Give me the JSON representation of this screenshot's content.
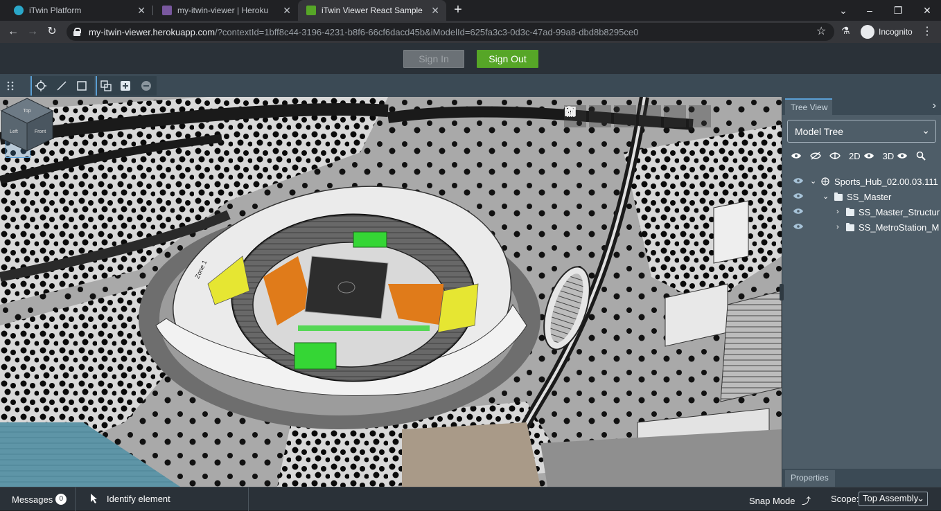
{
  "browser": {
    "tabs": [
      {
        "title": "iTwin Platform",
        "active": false
      },
      {
        "title": "my-itwin-viewer | Heroku",
        "active": false
      },
      {
        "title": "iTwin Viewer React Sample",
        "active": true
      }
    ],
    "url_host": "my-itwin-viewer.herokuapp.com",
    "url_rest": "/?contextId=1bff8c44-3196-4231-b8f6-66cf6dacd45b&iModelId=625fa3c3-0d3c-47ad-99a8-dbd8b8295ce0",
    "profile_label": "Incognito"
  },
  "header": {
    "signin_label": "Sign In",
    "signout_label": "Sign Out"
  },
  "tree_panel": {
    "tab_label": "Tree View",
    "select_value": "Model Tree",
    "toolbar_2d": "2D",
    "toolbar_3d": "3D",
    "nodes": [
      {
        "label": "Sports_Hub_02.00.03.111"
      },
      {
        "label": "SS_Master"
      },
      {
        "label": "SS_Master_Structur"
      },
      {
        "label": "SS_MetroStation_M"
      }
    ],
    "properties_tab": "Properties"
  },
  "statusbar": {
    "messages_label": "Messages",
    "messages_count": "0",
    "identify_label": "Identify element",
    "snap_label": "Snap Mode",
    "scope_label": "Scope:",
    "scope_value": "Top Assembly"
  },
  "navcube": {
    "faces": [
      "Top",
      "Left",
      "Front"
    ]
  },
  "viewport": {
    "zone_label": "Zone 1"
  },
  "colors": {
    "accent": "#5a9fd4",
    "signout": "#56a627",
    "panel": "#4e5d68",
    "toolbar": "#3b4a55",
    "header": "#2a3138"
  }
}
